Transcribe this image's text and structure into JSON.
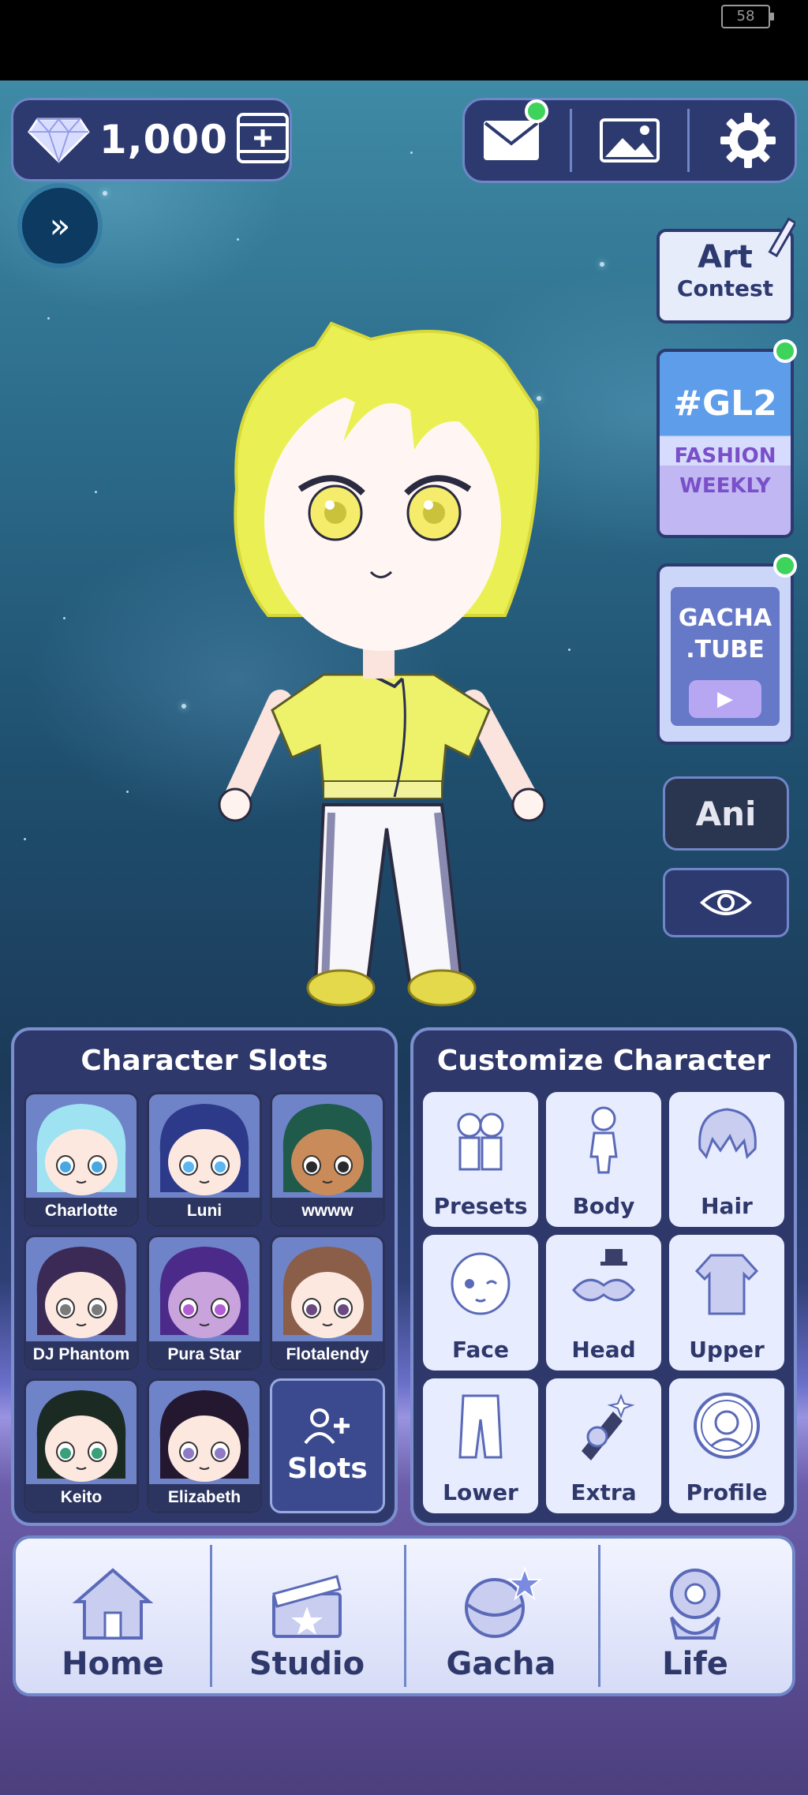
{
  "status": {
    "battery": "58"
  },
  "currency": {
    "amount": "1,000",
    "icon": "diamond-icon"
  },
  "top_actions": [
    {
      "name": "mail-icon",
      "has_notification": true
    },
    {
      "name": "gallery-icon",
      "has_notification": false
    },
    {
      "name": "gear-icon",
      "has_notification": false
    }
  ],
  "sidebar": {
    "expand_icon": "»",
    "art_contest": {
      "line1": "Art",
      "line2": "Contest"
    },
    "fashion": {
      "tag": "#GL2",
      "line1": "FASHION",
      "line2": "WEEKLY"
    },
    "gacha_tube": {
      "line1": "GACHA",
      "line2": ".TUBE",
      "play": "▶"
    },
    "ani_label": "Ani"
  },
  "character_slots": {
    "title": "Character Slots",
    "slots": [
      {
        "name": "Charlotte",
        "hair": "#9fe3f2",
        "eyes": "#4aa6e0",
        "skin": "#fde8e0"
      },
      {
        "name": "Luni",
        "hair": "#2d3a8a",
        "eyes": "#5cb6f0",
        "skin": "#fde8e0"
      },
      {
        "name": "wwww",
        "hair": "#1f5a4a",
        "eyes": "#2a2a2a",
        "skin": "#c98b5a"
      },
      {
        "name": "DJ Phantom",
        "hair": "#3a2a55",
        "eyes": "#7a7a7a",
        "skin": "#fde8e0"
      },
      {
        "name": "Pura Star",
        "hair": "#4b2a8a",
        "eyes": "#b25cd6",
        "skin": "#c9a3dc"
      },
      {
        "name": "Flotalendy",
        "hair": "#8a5e48",
        "eyes": "#6a4a80",
        "skin": "#fde8e0"
      },
      {
        "name": "Keito",
        "hair": "#1b2a22",
        "eyes": "#3aa07a",
        "skin": "#fde8e0"
      },
      {
        "name": "Elizabeth",
        "hair": "#241830",
        "eyes": "#8f7ac8",
        "skin": "#fde8e0"
      }
    ],
    "add_slot_label": "Slots"
  },
  "customize": {
    "title": "Customize Character",
    "buttons": [
      {
        "label": "Presets",
        "icon": "presets-icon"
      },
      {
        "label": "Body",
        "icon": "body-icon"
      },
      {
        "label": "Hair",
        "icon": "hair-icon"
      },
      {
        "label": "Face",
        "icon": "face-icon"
      },
      {
        "label": "Head",
        "icon": "head-icon"
      },
      {
        "label": "Upper",
        "icon": "upper-icon"
      },
      {
        "label": "Lower",
        "icon": "lower-icon"
      },
      {
        "label": "Extra",
        "icon": "extra-icon"
      },
      {
        "label": "Profile",
        "icon": "profile-icon"
      }
    ]
  },
  "nav": [
    {
      "label": "Home",
      "icon": "home-icon"
    },
    {
      "label": "Studio",
      "icon": "clapperboard-icon"
    },
    {
      "label": "Gacha",
      "icon": "gacha-icon"
    },
    {
      "label": "Life",
      "icon": "flower-icon"
    }
  ],
  "colors": {
    "panel": "#2f386b",
    "accent": "#6f86c8",
    "notification": "#3ed35a"
  }
}
